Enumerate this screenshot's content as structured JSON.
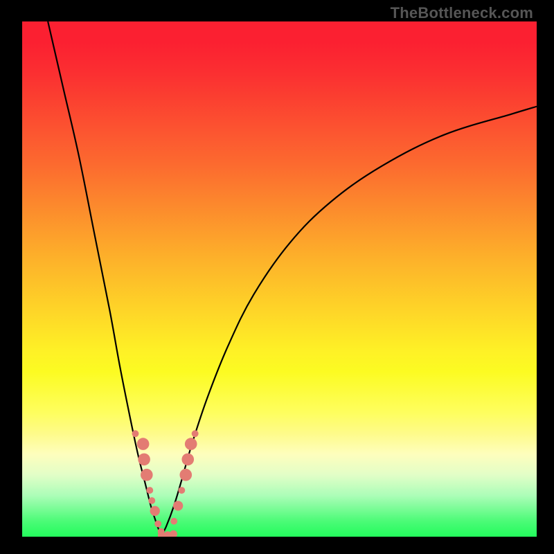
{
  "watermark": "TheBottleneck.com",
  "colors": {
    "frame": "#000000",
    "curve": "#000000",
    "marker": "#e37c73"
  },
  "chart_data": {
    "type": "line",
    "title": "",
    "xlabel": "",
    "ylabel": "",
    "xlim": [
      0,
      100
    ],
    "ylim": [
      0,
      100
    ],
    "grid": false,
    "legend": false,
    "series": [
      {
        "name": "left-curve",
        "x": [
          5,
          8,
          11,
          14,
          17,
          19,
          21,
          22.5,
          24,
          25,
          25.8,
          26.5,
          27.1
        ],
        "y": [
          100,
          87,
          74,
          59,
          44,
          33,
          23,
          16,
          10,
          6,
          3.5,
          1.5,
          0.3
        ]
      },
      {
        "name": "right-curve",
        "x": [
          27.1,
          28,
          29.5,
          31,
          33,
          36,
          40,
          45,
          52,
          60,
          70,
          82,
          95,
          100
        ],
        "y": [
          0.3,
          2,
          6,
          11,
          18,
          27,
          37,
          47,
          57,
          65,
          72,
          78,
          82,
          83.5
        ]
      }
    ],
    "markers": [
      {
        "x": 22.0,
        "y": 20,
        "r": 0.9
      },
      {
        "x": 23.5,
        "y": 18,
        "r": 1.6
      },
      {
        "x": 23.7,
        "y": 15,
        "r": 1.6
      },
      {
        "x": 24.2,
        "y": 12,
        "r": 1.6
      },
      {
        "x": 24.8,
        "y": 9,
        "r": 0.9
      },
      {
        "x": 25.2,
        "y": 7,
        "r": 0.9
      },
      {
        "x": 25.8,
        "y": 5,
        "r": 1.3
      },
      {
        "x": 26.4,
        "y": 2.5,
        "r": 0.9
      },
      {
        "x": 27.0,
        "y": 1,
        "r": 0.9
      },
      {
        "x": 27.1,
        "y": 0.3,
        "r": 1.0
      },
      {
        "x": 28.3,
        "y": 0.3,
        "r": 1.0
      },
      {
        "x": 29.4,
        "y": 0.5,
        "r": 1.0
      },
      {
        "x": 29.5,
        "y": 3,
        "r": 0.9
      },
      {
        "x": 30.3,
        "y": 6,
        "r": 1.3
      },
      {
        "x": 31.0,
        "y": 9,
        "r": 0.9
      },
      {
        "x": 31.8,
        "y": 12,
        "r": 1.6
      },
      {
        "x": 32.2,
        "y": 15,
        "r": 1.6
      },
      {
        "x": 32.8,
        "y": 18,
        "r": 1.6
      },
      {
        "x": 33.6,
        "y": 20,
        "r": 0.9
      }
    ],
    "notes": "V-shaped bottleneck curve. Values are approximate readings from the image; axes have no visible tick labels so x and y are treated as 0–100% of plot width/height."
  }
}
